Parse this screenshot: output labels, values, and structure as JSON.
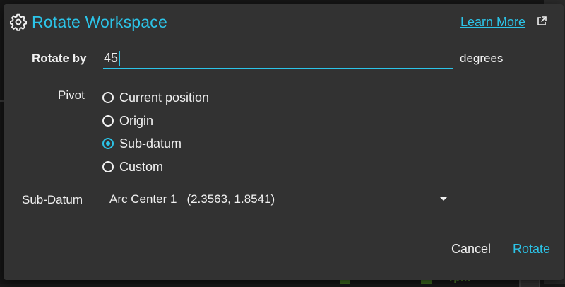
{
  "dialog": {
    "title": "Rotate Workspace",
    "title_icon": "gear-icon",
    "learn_more": "Learn More",
    "learn_more_icon": "external-link-icon",
    "accent_color": "#2cc4e8"
  },
  "rotate": {
    "label": "Rotate by",
    "value": "45",
    "unit": "degrees"
  },
  "pivot": {
    "label": "Pivot",
    "options": [
      {
        "label": "Current position",
        "checked": false
      },
      {
        "label": "Origin",
        "checked": false
      },
      {
        "label": "Sub-datum",
        "checked": true
      },
      {
        "label": "Custom",
        "checked": false
      }
    ]
  },
  "subdatum": {
    "label": "Sub-Datum",
    "selected_name": "Arc Center 1",
    "selected_coords": "(2.3563, 1.8541)"
  },
  "actions": {
    "cancel": "Cancel",
    "rotate": "Rotate"
  },
  "background": {
    "rpm_text": "rpm"
  }
}
